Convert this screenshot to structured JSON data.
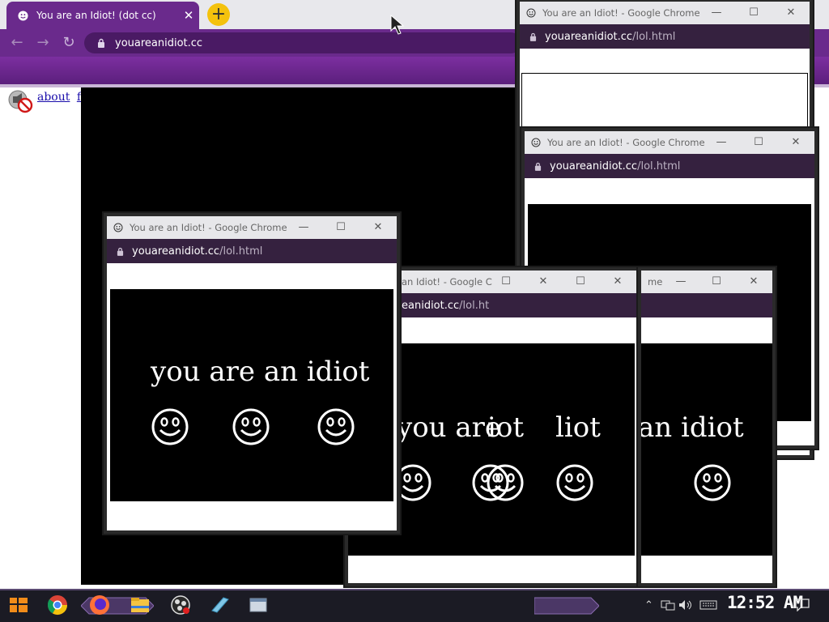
{
  "browser": {
    "tab_title": "You are an Idiot! (dot cc)",
    "tab_close": "✕",
    "new_tab": "+",
    "nav_back": "←",
    "nav_forward": "→",
    "nav_reload": "↻",
    "url": "youareanidiot.cc"
  },
  "page": {
    "links": [
      "about",
      "flash"
    ]
  },
  "popups": [
    {
      "title": "You are an Idiot! - Google Chrome",
      "url_host": "youareanidiot.cc",
      "url_path": "/lol.html",
      "text": "",
      "minimize": "—",
      "maximize": "☐",
      "close": "✕"
    },
    {
      "title": "You are an Idiot! - Google Chrome",
      "url_host": "youareanidiot.cc",
      "url_path": "/lol.html",
      "text": "",
      "minimize": "—",
      "maximize": "☐",
      "close": "✕"
    },
    {
      "title": "You are an Idiot! - Google Chrome",
      "url_host": "youareanidiot.cc",
      "url_path": "/lol.html",
      "text": "you are an idiot",
      "minimize": "—",
      "maximize": "☐",
      "close": "✕"
    },
    {
      "title": "an Idiot! - Google C",
      "url_host": "eanidiot.cc",
      "url_path": "/lol.ht",
      "text": "you are",
      "text2": "iot",
      "text3": "liot",
      "minimize": "☐",
      "maximize": "☐",
      "close": "✕"
    },
    {
      "title": "me",
      "url_host": "",
      "url_path": "",
      "text": "an idiot",
      "minimize": "—",
      "maximize": "☐",
      "close": "✕"
    }
  ],
  "taskbar": {
    "clock": "12:52 AM",
    "icons": [
      "start-icon",
      "chrome-icon",
      "firefox-icon",
      "file-explorer-icon",
      "obs-icon",
      "notepad-icon",
      "window-icon"
    ]
  },
  "colors": {
    "chrome_accent": "#6a2a8c",
    "popup_address_bar": "#35213f",
    "new_tab_button": "#f4c20d"
  }
}
